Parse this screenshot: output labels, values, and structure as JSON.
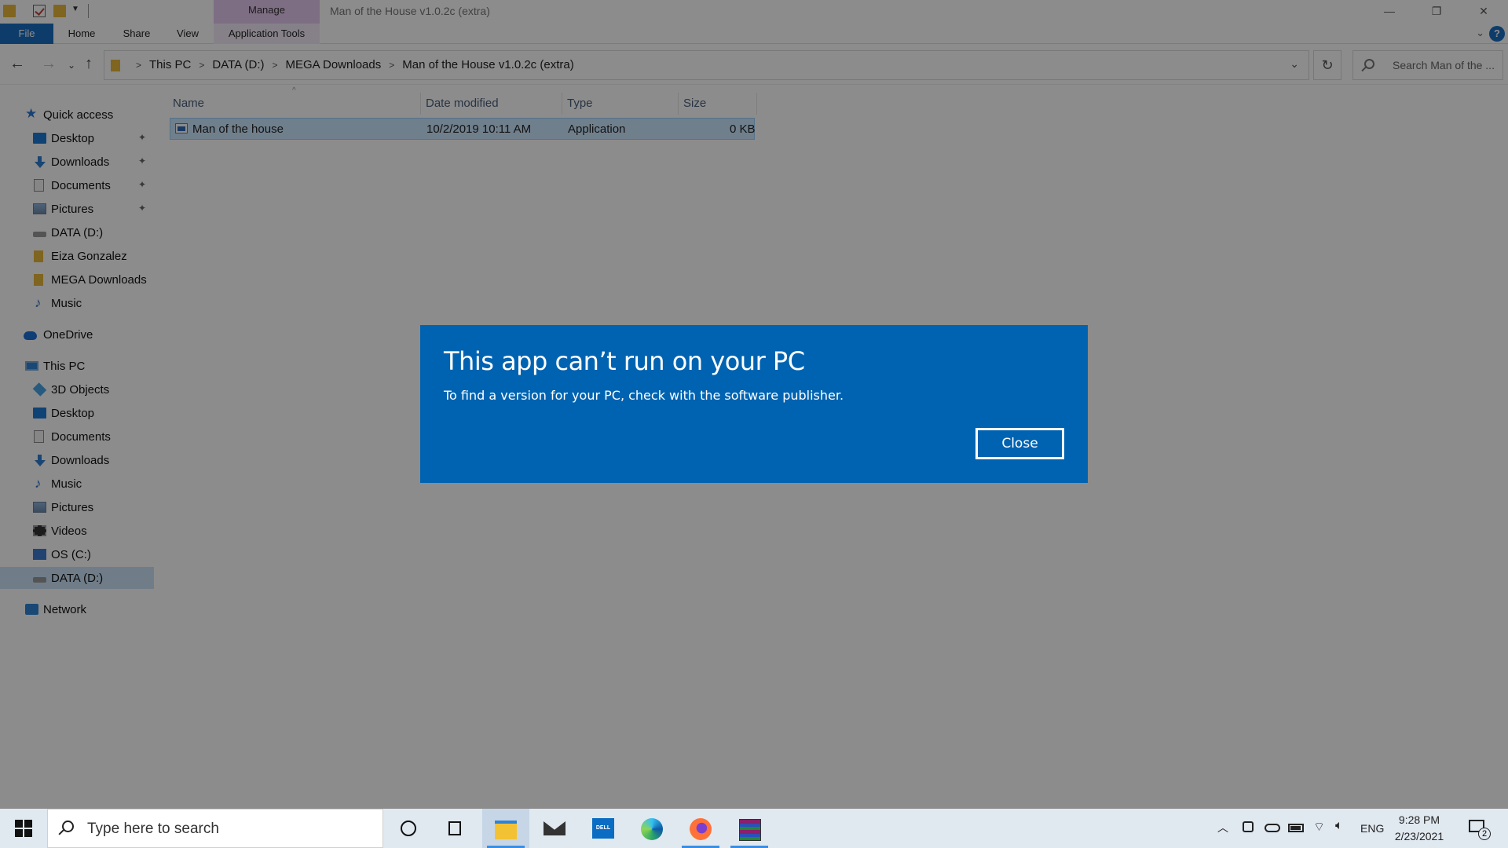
{
  "window": {
    "title": "Man of the House v1.0.2c (extra)",
    "context_tab": "Manage",
    "controls": [
      "—",
      "❐",
      "✕"
    ]
  },
  "ribbon": {
    "tabs": [
      "File",
      "Home",
      "Share",
      "View",
      "Application Tools"
    ],
    "help": "?"
  },
  "address": {
    "breadcrumb": [
      "This PC",
      "DATA (D:)",
      "MEGA Downloads",
      "Man of the House v1.0.2c (extra)"
    ],
    "search_placeholder": "Search Man of the ..."
  },
  "nav_pane": {
    "quick_access": "Quick access",
    "quick_items": [
      "Desktop",
      "Downloads",
      "Documents",
      "Pictures",
      "DATA (D:)",
      "Eiza Gonzalez",
      "MEGA Downloads",
      "Music"
    ],
    "onedrive": "OneDrive",
    "this_pc": "This PC",
    "pc_items": [
      "3D Objects",
      "Desktop",
      "Documents",
      "Downloads",
      "Music",
      "Pictures",
      "Videos",
      "OS (C:)",
      "DATA (D:)"
    ],
    "network": "Network"
  },
  "file_list": {
    "columns": [
      "Name",
      "Date modified",
      "Type",
      "Size"
    ],
    "rows": [
      {
        "name": "Man of the house",
        "date": "10/2/2019 10:11 AM",
        "type": "Application",
        "size": "0 KB"
      }
    ]
  },
  "dialog": {
    "title": "This app can’t run on your PC",
    "message": "To find a version for your PC, check with the software publisher.",
    "close_label": "Close",
    "background": "#0063b1"
  },
  "taskbar": {
    "search_text": "Type here to search",
    "language": "ENG",
    "time": "9:28 PM",
    "date": "2/23/2021",
    "notification_count": "2",
    "icons": [
      "start-icon",
      "cortana-icon",
      "task-view-icon",
      "file-explorer-icon",
      "mail-icon",
      "dell-icon",
      "edge-icon",
      "firefox-icon",
      "winrar-icon"
    ]
  }
}
